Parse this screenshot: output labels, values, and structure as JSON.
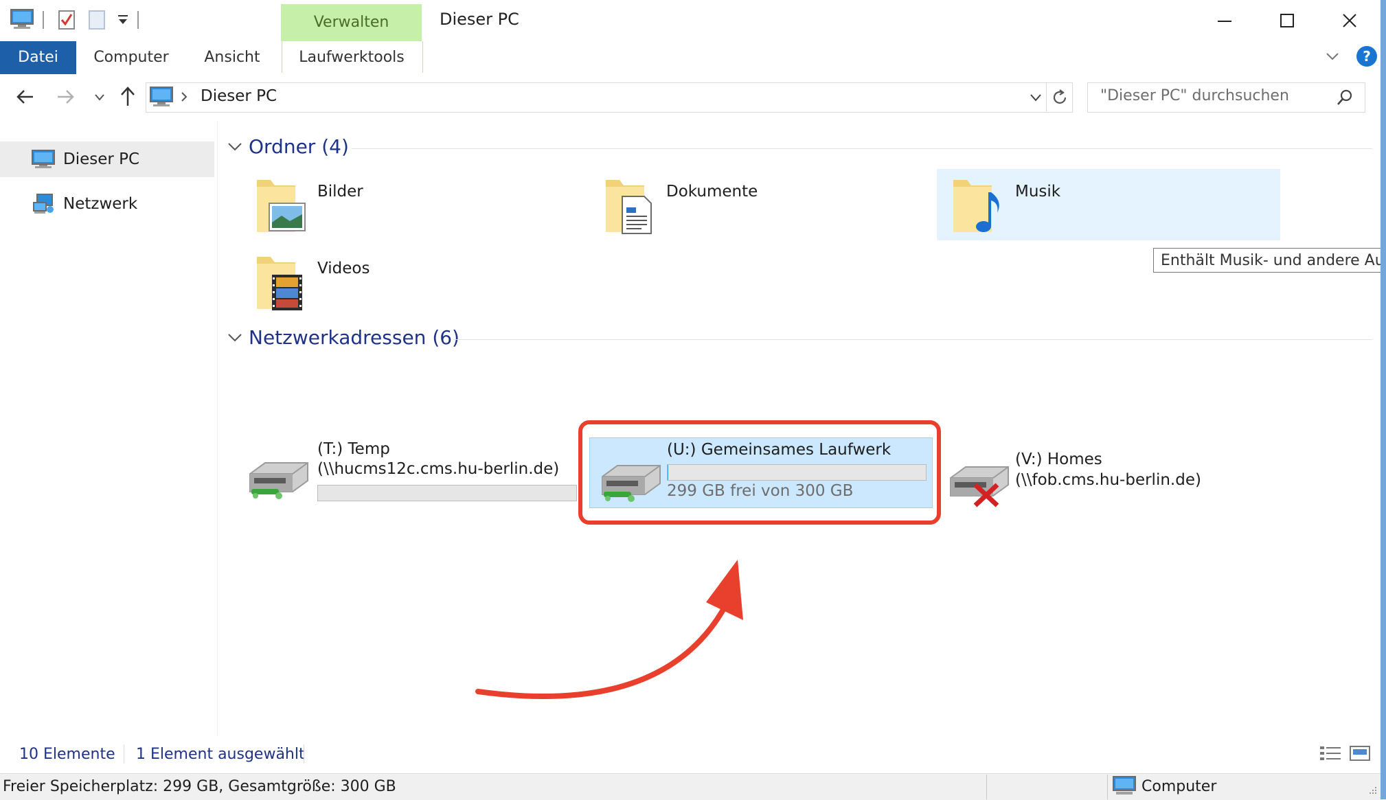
{
  "window": {
    "title": "Dieser PC",
    "context_group": "Verwalten"
  },
  "ribbon": {
    "tabs": [
      "Datei",
      "Computer",
      "Ansicht",
      "Laufwerktools"
    ]
  },
  "address": {
    "path": "Dieser PC",
    "search_placeholder": "\"Dieser PC\" durchsuchen"
  },
  "nav": {
    "items": [
      "Dieser PC",
      "Netzwerk"
    ]
  },
  "groups": {
    "folders_title": "Ordner (4)",
    "network_title": "Netzwerkadressen (6)"
  },
  "folders": [
    {
      "name": "Bilder",
      "icon": "pictures-folder-icon"
    },
    {
      "name": "Dokumente",
      "icon": "documents-folder-icon"
    },
    {
      "name": "Musik",
      "icon": "music-folder-icon"
    },
    {
      "name": "Videos",
      "icon": "videos-folder-icon"
    }
  ],
  "tooltip": "Enthält Musik- und andere Aud",
  "drives": [
    {
      "name": "(T:) Temp",
      "path": "(\\\\hucms12c.cms.hu-berlin.de)",
      "used_fraction": 0.0
    },
    {
      "name": "(U:) Gemeinsames Laufwerk",
      "free_text": "299 GB frei von 300 GB",
      "used_fraction": 0.003
    },
    {
      "name": "(V:) Homes",
      "path": "(\\\\fob.cms.hu-berlin.de)",
      "disconnected": true
    }
  ],
  "status": {
    "count": "10 Elemente",
    "selected": "1 Element ausgewählt",
    "details": "Freier Speicherplatz: 299 GB, Gesamtgröße: 300 GB",
    "location": "Computer"
  },
  "colors": {
    "accent": "#1d5fa9",
    "selection": "#cce8ff",
    "annotation": "#e8402c",
    "context_tab": "#c6efaa"
  }
}
